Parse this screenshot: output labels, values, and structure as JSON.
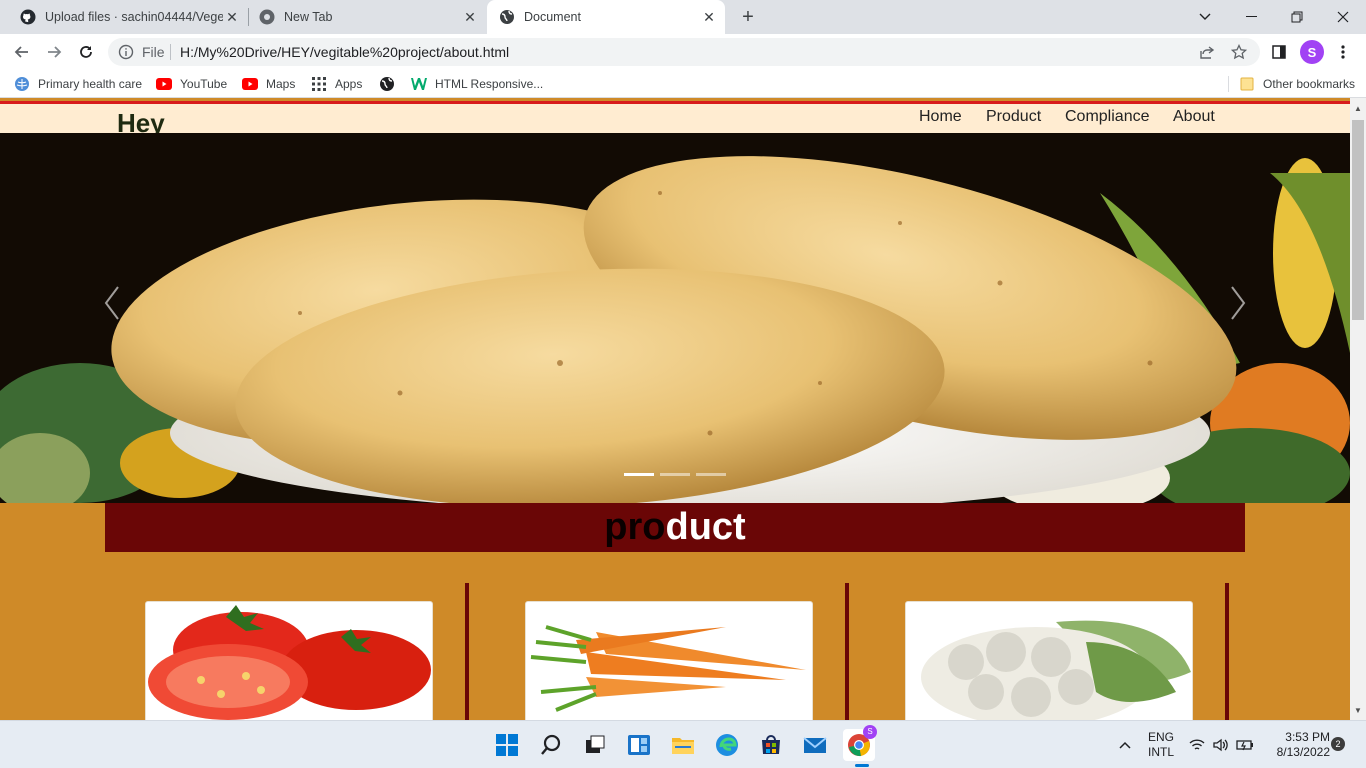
{
  "browser": {
    "tabs": [
      {
        "title": "Upload files · sachin04444/Veget",
        "favicon": "github-icon",
        "active": false
      },
      {
        "title": "New Tab",
        "favicon": "chrome-icon",
        "active": false
      },
      {
        "title": "Document",
        "favicon": "globe-icon",
        "active": true
      }
    ],
    "omnibox": {
      "scheme_label": "File",
      "url": "H:/My%20Drive/HEY/vegitable%20project/about.html"
    },
    "profile_initial": "S",
    "bookmarks": [
      {
        "label": "Primary health care",
        "icon": "who-icon"
      },
      {
        "label": "YouTube",
        "icon": "youtube-icon"
      },
      {
        "label": "Maps",
        "icon": "youtube-icon"
      },
      {
        "label": "Apps",
        "icon": "apps-grid-icon"
      },
      {
        "label": "",
        "icon": "globe-icon"
      },
      {
        "label": "HTML Responsive...",
        "icon": "w3schools-icon"
      }
    ],
    "other_bookmarks": "Other bookmarks"
  },
  "site": {
    "brand": "Hey",
    "nav": [
      "Home",
      "Product",
      "Compliance",
      "About"
    ],
    "hero": {
      "image": "potatoes-on-vegetables",
      "slides": 3,
      "active_slide": 1
    },
    "product_title_part1": "pro",
    "product_title_part2": "duct",
    "products": [
      {
        "image": "tomato"
      },
      {
        "image": "carrot"
      },
      {
        "image": "cauliflower"
      }
    ]
  },
  "taskbar": {
    "apps": [
      "windows-start-icon",
      "search-icon",
      "task-view-icon",
      "widgets-icon",
      "file-explorer-icon",
      "edge-icon",
      "store-icon",
      "mail-icon",
      "chrome-icon"
    ],
    "language": "ENG",
    "layout": "INTL",
    "time": "3:53 PM",
    "date": "8/13/2022",
    "notifications": "2"
  },
  "colors": {
    "nav_bg": "#ffecd1",
    "page_bg": "#cf8a28",
    "band_bg": "#6a0606",
    "accent_line": "#d81b1b"
  }
}
